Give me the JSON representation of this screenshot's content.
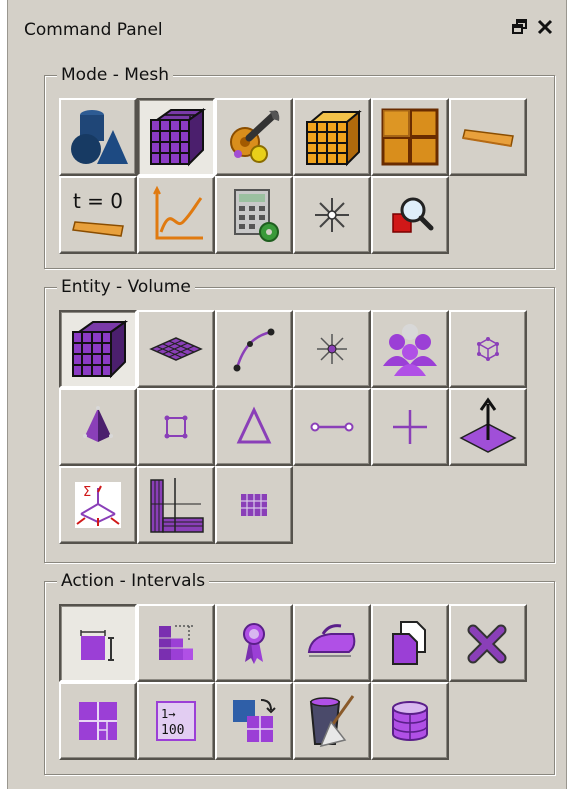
{
  "window": {
    "title": "Command Panel",
    "restore_icon": "restore-window-icon",
    "close_icon": "close-icon"
  },
  "groups": {
    "mode": {
      "label": "Mode - Mesh",
      "buttons": [
        "geometry-icon",
        "mesh-icon",
        "tools-icon",
        "volume-mesh-icon",
        "surface-mesh-icon",
        "curve-mesh-icon",
        "time-zero-icon",
        "graph-icon",
        "calculator-icon",
        "vertex-star-icon",
        "zoom-search-icon"
      ],
      "active": 1,
      "t0_label": "t = 0"
    },
    "entity": {
      "label": "Entity - Volume",
      "buttons": [
        "volume-icon",
        "surface-icon",
        "curve-icon",
        "vertex-icon",
        "group-icon",
        "node-set-icon",
        "pyramid-icon",
        "square-node-icon",
        "triangle-icon",
        "edge-icon",
        "node-icon",
        "normal-icon",
        "sideset-icon",
        "block-icon",
        "hex-grid-icon"
      ],
      "active": 0,
      "sigma_label": "Σ"
    },
    "action": {
      "label": "Action - Intervals",
      "buttons": [
        "intervals-icon",
        "scheme-icon",
        "quality-icon",
        "smooth-icon",
        "copy-icon",
        "delete-icon",
        "refine-icon",
        "numbering-icon",
        "swap-icon",
        "cleanup-icon",
        "database-icon"
      ],
      "active": 0,
      "numbering_top": "1→",
      "numbering_bottom": "100"
    }
  },
  "colors": {
    "panel_bg": "#d4d0c8",
    "accent_purple": "#9b3fd6",
    "mesh_orange": "#d98e1c",
    "geometry_blue": "#1c3f6e"
  }
}
